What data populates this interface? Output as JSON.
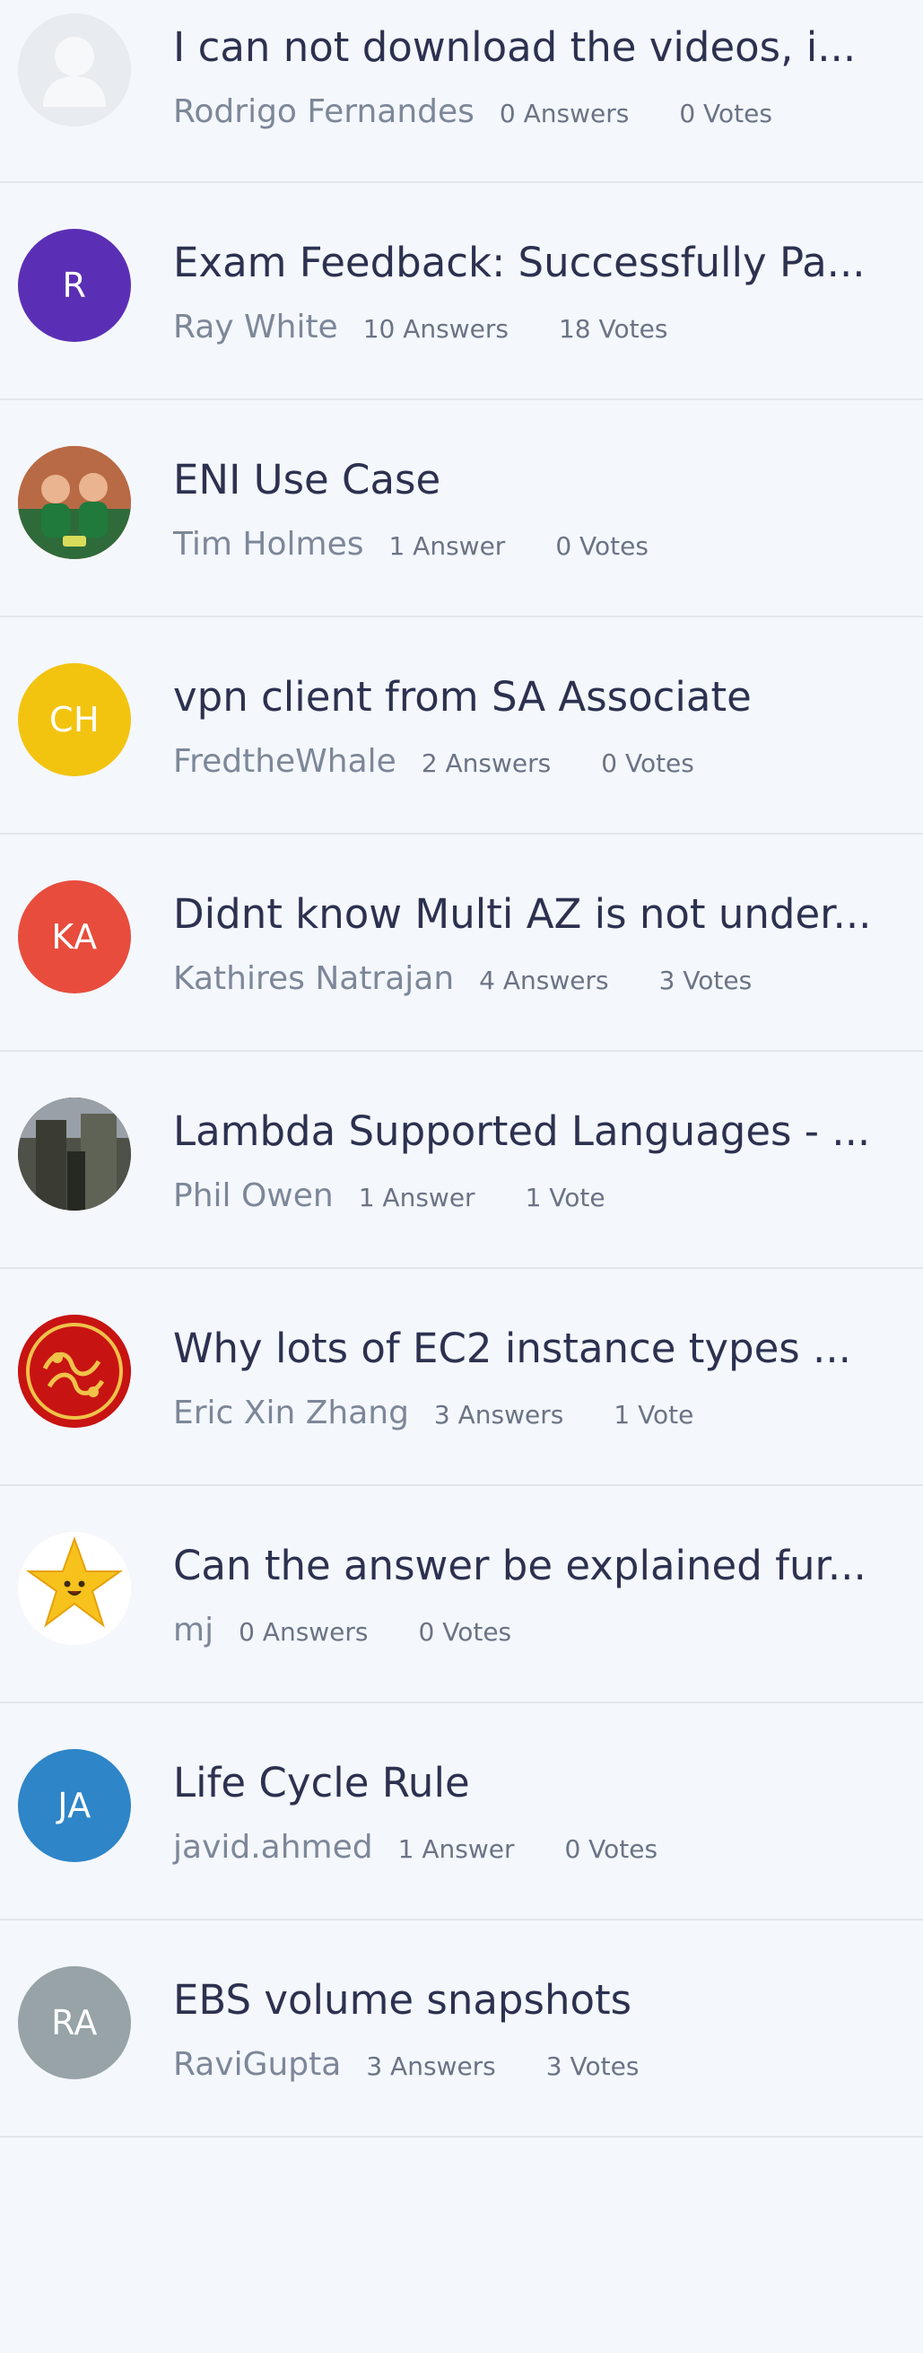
{
  "questions": [
    {
      "title": "I can not download the videos, i...",
      "author": "Rodrigo Fernandes",
      "answers": "0 Answers",
      "votes": "0 Votes",
      "avatar_type": "placeholder-icon",
      "avatar_bg": "#e8ebef"
    },
    {
      "title": "Exam Feedback: Successfully Pa...",
      "author": "Ray White",
      "answers": "10 Answers",
      "votes": "18 Votes",
      "avatar_initials": "R",
      "avatar_bg": "#5b2fb5"
    },
    {
      "title": "ENI Use Case",
      "author": "Tim Holmes",
      "answers": "1 Answer",
      "votes": "0 Votes",
      "avatar_type": "photo",
      "avatar_bg": "#a45c3a"
    },
    {
      "title": "vpn client from SA Associate",
      "author": "FredtheWhale",
      "answers": "2 Answers",
      "votes": "0 Votes",
      "avatar_initials": "CH",
      "avatar_bg": "#f2c40f"
    },
    {
      "title": "Didnt know Multi AZ is not under...",
      "author": "Kathires Natrajan",
      "answers": "4 Answers",
      "votes": "3 Votes",
      "avatar_initials": "KA",
      "avatar_bg": "#e84c3d"
    },
    {
      "title": "Lambda Supported Languages - ...",
      "author": "Phil Owen",
      "answers": "1 Answer",
      "votes": "1 Vote",
      "avatar_type": "photo",
      "avatar_bg": "#3b3b34"
    },
    {
      "title": "Why lots of EC2 instance types ...",
      "author": "Eric Xin Zhang",
      "answers": "3 Answers",
      "votes": "1 Vote",
      "avatar_type": "pattern",
      "avatar_bg": "#c81313"
    },
    {
      "title": "Can the answer be explained fur...",
      "author": "mj",
      "answers": "0 Answers",
      "votes": "0 Votes",
      "avatar_type": "star-icon",
      "avatar_bg": "#ffffff"
    },
    {
      "title": "Life Cycle Rule",
      "author": "javid.ahmed",
      "answers": "1 Answer",
      "votes": "0 Votes",
      "avatar_initials": "JA",
      "avatar_bg": "#2e85c8"
    },
    {
      "title": "EBS volume snapshots",
      "author": "RaviGupta",
      "answers": "3 Answers",
      "votes": "3 Votes",
      "avatar_initials": "RA",
      "avatar_bg": "#97a3a6"
    }
  ]
}
